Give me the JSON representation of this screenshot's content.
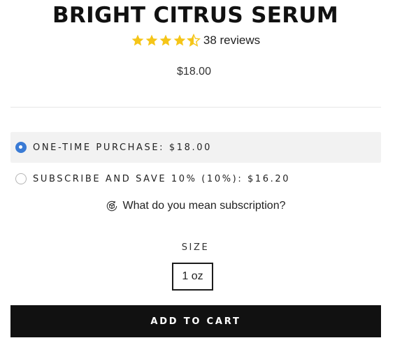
{
  "product": {
    "title": "BRIGHT CITRUS SERUM",
    "rating": 4.5,
    "rating_max": 5,
    "star_color": "#f5c518",
    "reviews_label": "38 reviews",
    "price": "$18.00"
  },
  "purchase_options": [
    {
      "label": "ONE-TIME PURCHASE: $18.00",
      "selected": true
    },
    {
      "label": "SUBSCRIBE AND SAVE 10% (10%): $16.20",
      "selected": false
    }
  ],
  "subscription_help": {
    "icon": "subscription-box-icon",
    "text": "What do you mean subscription?"
  },
  "size": {
    "label": "SIZE",
    "selected": "1 oz"
  },
  "add_to_cart_label": "ADD TO CART"
}
